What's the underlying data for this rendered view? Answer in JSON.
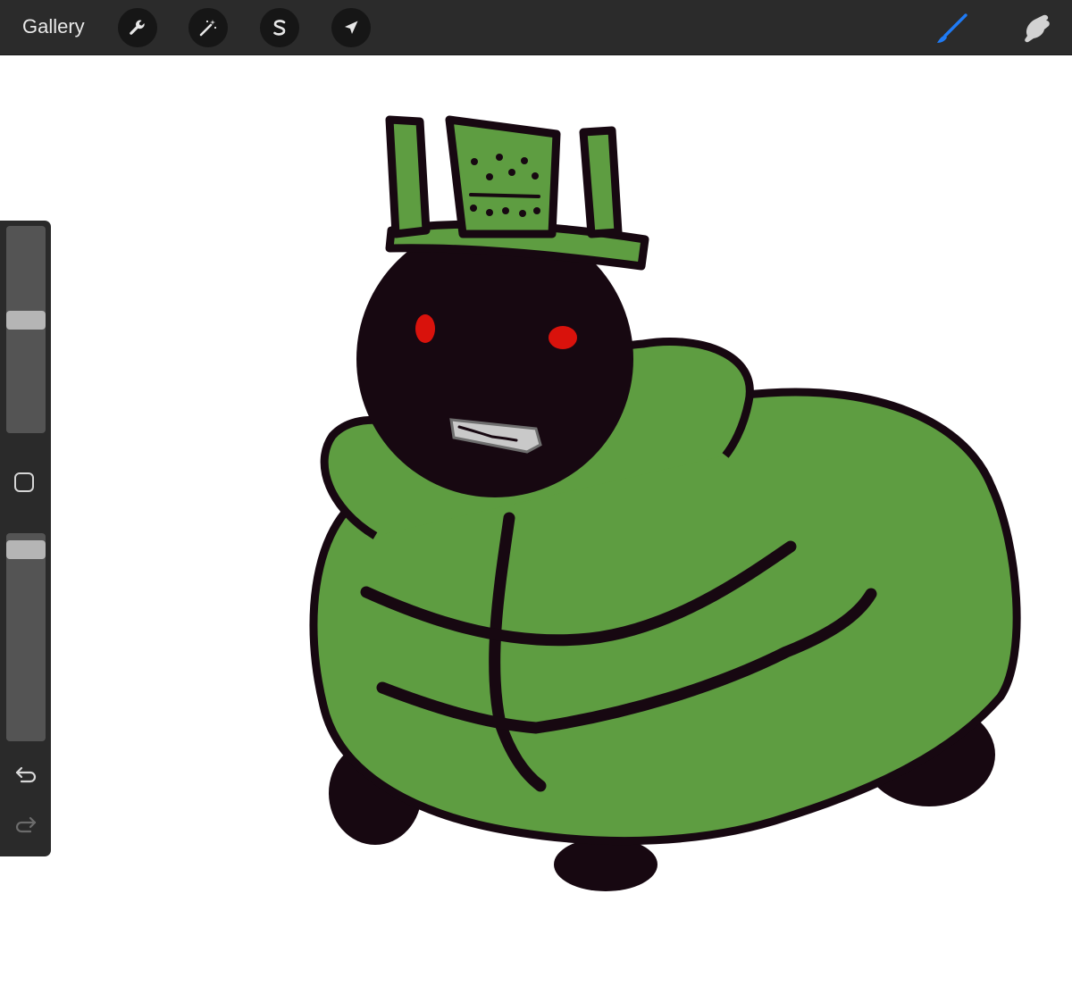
{
  "toolbar": {
    "gallery_label": "Gallery",
    "actions_icon": "wrench-icon",
    "adjustments_icon": "magic-wand-icon",
    "selection_icon": "selection-s-icon",
    "transform_icon": "arrow-cursor-icon",
    "brush_icon": "brush-icon",
    "smudge_icon": "smudge-finger-icon",
    "brush_active_color": "#1f7bf5"
  },
  "sidebar": {
    "brush_size_level": 0.55,
    "opacity_level": 0.96,
    "modify_icon": "square-outline-icon",
    "undo_icon": "undo-arrow-icon",
    "redo_icon": "redo-arrow-icon"
  },
  "canvas": {
    "background": "#ffffff",
    "palette": {
      "outline": "#170811",
      "green": "#5e9d41",
      "eyes": "#d9120c",
      "teeth": "#c9c9c9"
    }
  }
}
